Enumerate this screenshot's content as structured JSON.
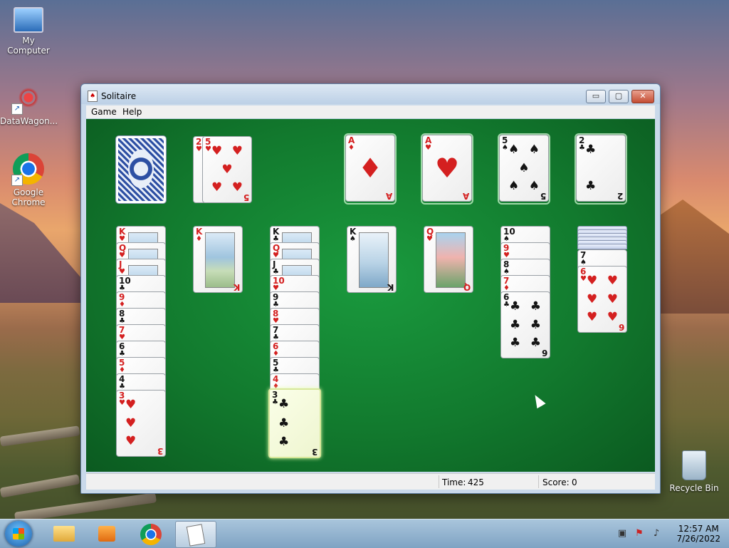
{
  "desktop": {
    "icons": [
      {
        "label": "My Computer"
      },
      {
        "label": "DataWagon..."
      },
      {
        "label": "Google Chrome"
      },
      {
        "label": "Recycle Bin"
      }
    ]
  },
  "window": {
    "title": "Solitaire",
    "controls": {
      "minimize": "▭",
      "maximize": "▢",
      "close": "✕"
    },
    "menu": [
      "Game",
      "Help"
    ]
  },
  "game": {
    "stock": {
      "face_down": true
    },
    "waste": [
      "2♥",
      "5♥"
    ],
    "foundations": [
      "A♦",
      "A♥",
      "5♠",
      "2♣"
    ],
    "tableau": [
      [
        "K♥",
        "Q♥",
        "J♥",
        "10♣",
        "9♦",
        "8♣",
        "7♥",
        "6♣",
        "5♦",
        "4♣",
        "3♥"
      ],
      [
        "K♦"
      ],
      [
        "K♣",
        "Q♥",
        "J♣",
        "10♥",
        "9♣",
        "8♥",
        "7♣",
        "6♦",
        "5♣",
        "4♦",
        "3♣"
      ],
      [
        "K♠"
      ],
      [
        "Q♥"
      ],
      [
        "10♠",
        "9♥",
        "8♠",
        "7♦",
        "6♣"
      ],
      [
        "7♠",
        "6♥"
      ]
    ],
    "tableau_face_down_counts": [
      0,
      0,
      0,
      0,
      0,
      0,
      6
    ]
  },
  "status": {
    "time_label": "Time:",
    "time_value": "425",
    "score_label": "Score:",
    "score_value": "0"
  },
  "taskbar": {
    "clock_time": "12:57 AM",
    "clock_date": "7/26/2022"
  },
  "colors": {
    "felt": "#127a2e",
    "card_red": "#d42020",
    "card_black": "#151515"
  }
}
